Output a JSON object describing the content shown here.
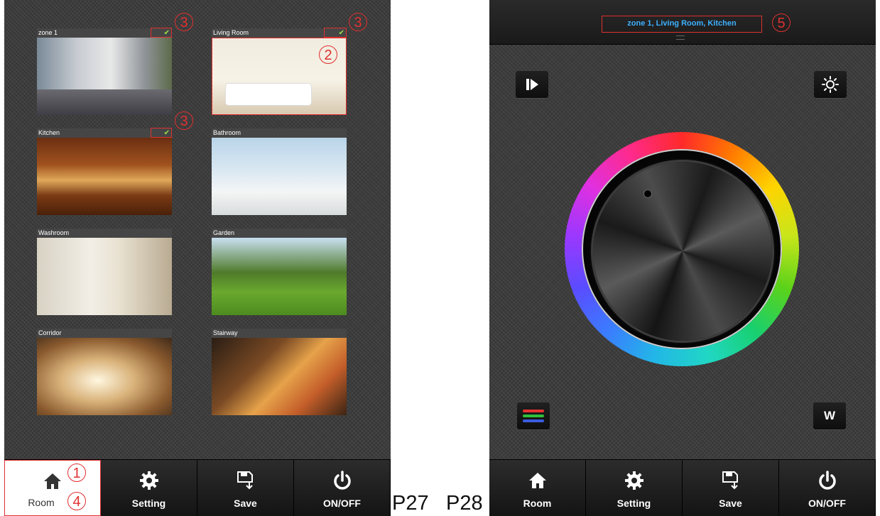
{
  "left_screen": {
    "rooms": [
      {
        "name": "zone 1",
        "checked": true
      },
      {
        "name": "Living Room",
        "checked": true
      },
      {
        "name": "Kitchen",
        "checked": true
      },
      {
        "name": "Bathroom",
        "checked": false
      },
      {
        "name": "Washroom",
        "checked": false
      },
      {
        "name": "Garden",
        "checked": false
      },
      {
        "name": "Corridor",
        "checked": false
      },
      {
        "name": "Stairway",
        "checked": false
      }
    ],
    "check_glyph": "✔",
    "markers": {
      "m1": "1",
      "m2": "2",
      "m3": "3",
      "m4": "4"
    },
    "tabs": [
      {
        "label": "Room",
        "icon": "home-icon",
        "active": true
      },
      {
        "label": "Setting",
        "icon": "gear-icon",
        "active": false
      },
      {
        "label": "Save",
        "icon": "save-icon",
        "active": false
      },
      {
        "label": "ON/OFF",
        "icon": "power-icon",
        "active": false
      }
    ]
  },
  "page_labels": {
    "left": "P27",
    "right": "P28"
  },
  "right_screen": {
    "selected_zones": "zone 1, Living Room, Kitchen",
    "marker": "5",
    "buttons": {
      "play": "play-pause-icon",
      "brightness": "brightness-icon",
      "rgb": "rgb-bars-icon",
      "white_label": "W"
    },
    "tabs": [
      {
        "label": "Room",
        "icon": "home-icon"
      },
      {
        "label": "Setting",
        "icon": "gear-icon"
      },
      {
        "label": "Save",
        "icon": "save-icon"
      },
      {
        "label": "ON/OFF",
        "icon": "power-icon"
      }
    ]
  },
  "colors": {
    "marker": "#e03030",
    "check": "#9be04a",
    "zone_text": "#3db1ff"
  }
}
